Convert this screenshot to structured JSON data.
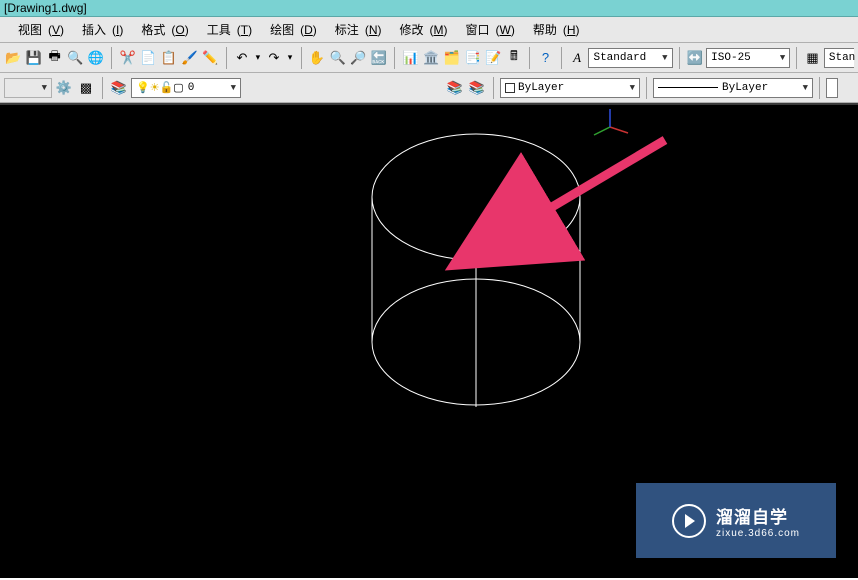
{
  "title": "[Drawing1.dwg]",
  "menu": {
    "view": {
      "label": "视图",
      "accel": "V"
    },
    "insert": {
      "label": "插入",
      "accel": "I"
    },
    "format": {
      "label": "格式",
      "accel": "O"
    },
    "tools": {
      "label": "工具",
      "accel": "T"
    },
    "draw": {
      "label": "绘图",
      "accel": "D"
    },
    "dim": {
      "label": "标注",
      "accel": "N"
    },
    "modify": {
      "label": "修改",
      "accel": "M"
    },
    "window": {
      "label": "窗口",
      "accel": "W"
    },
    "help": {
      "label": "帮助",
      "accel": "H"
    }
  },
  "styles": {
    "text_style": "Standard",
    "dim_style": "ISO-25",
    "table_style_btn": "Stan"
  },
  "layer": {
    "current_color_label": "ByLayer",
    "current_linetype_label": "ByLayer",
    "layer_list_value": "0"
  },
  "watermark": {
    "name": "溜溜自学",
    "url": "zixue.3d66.com"
  },
  "colors": {
    "arrow": "#E8366B",
    "ucs_x": "#C83232",
    "ucs_y": "#2FA02F",
    "ucs_z": "#2F4FE0"
  }
}
